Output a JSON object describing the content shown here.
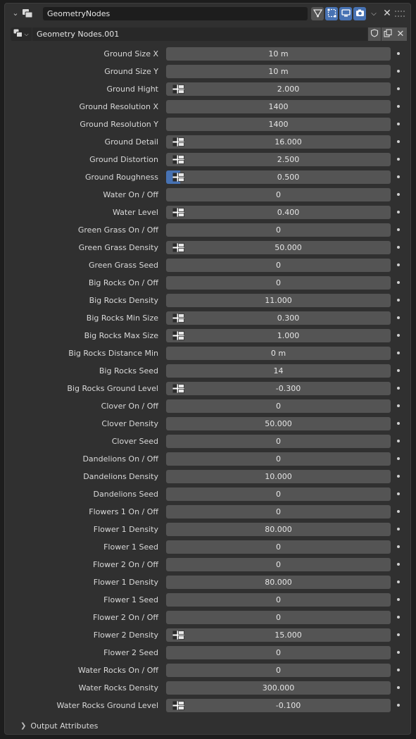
{
  "modifier": {
    "name": "GeometryNodes",
    "icon": "geometry-nodes-modifier-icon",
    "toggles": [
      {
        "icon": "edit-mode-icon",
        "active": false
      },
      {
        "icon": "on-cage-icon",
        "active": true
      },
      {
        "icon": "realtime-display-icon",
        "active": true
      },
      {
        "icon": "render-camera-icon",
        "active": true
      }
    ]
  },
  "node_group": {
    "name": "Geometry Nodes.001",
    "type_icon": "node-tree-icon"
  },
  "properties": [
    {
      "label": "Ground Size X",
      "value": "10 m",
      "icon": false
    },
    {
      "label": "Ground Size Y",
      "value": "10 m",
      "icon": false
    },
    {
      "label": "Ground Hight",
      "value": "2.000",
      "icon": true
    },
    {
      "label": "Ground Resolution X",
      "value": "1400",
      "icon": false
    },
    {
      "label": "Ground Resolution Y",
      "value": "1400",
      "icon": false
    },
    {
      "label": "Ground Detail",
      "value": "16.000",
      "icon": true
    },
    {
      "label": "Ground Distortion",
      "value": "2.500",
      "icon": true
    },
    {
      "label": "Ground Roughness",
      "value": "0.500",
      "icon": true,
      "fill": 0.5
    },
    {
      "label": "Water On / Off",
      "value": "0",
      "icon": false
    },
    {
      "label": "Water Level",
      "value": "0.400",
      "icon": true
    },
    {
      "label": "Green Grass On / Off",
      "value": "0",
      "icon": false
    },
    {
      "label": "Green Grass Density",
      "value": "50.000",
      "icon": true
    },
    {
      "label": "Green Grass Seed",
      "value": "0",
      "icon": false
    },
    {
      "label": "Big Rocks On / Off",
      "value": "0",
      "icon": false
    },
    {
      "label": "Big Rocks Density",
      "value": "11.000",
      "icon": false
    },
    {
      "label": "Big Rocks Min Size",
      "value": "0.300",
      "icon": true
    },
    {
      "label": "Big Rocks Max Size",
      "value": "1.000",
      "icon": true
    },
    {
      "label": "Big Rocks Distance Min",
      "value": "0 m",
      "icon": false
    },
    {
      "label": "Big Rocks Seed",
      "value": "14",
      "icon": false
    },
    {
      "label": "Big Rocks Ground Level",
      "value": "-0.300",
      "icon": true
    },
    {
      "label": "Clover On / Off",
      "value": "0",
      "icon": false
    },
    {
      "label": "Clover Density",
      "value": "50.000",
      "icon": false
    },
    {
      "label": "Clover Seed",
      "value": "0",
      "icon": false
    },
    {
      "label": "Dandelions On / Off",
      "value": "0",
      "icon": false
    },
    {
      "label": "Dandelions Density",
      "value": "10.000",
      "icon": false
    },
    {
      "label": "Dandelions Seed",
      "value": "0",
      "icon": false
    },
    {
      "label": "Flowers 1 On / Off",
      "value": "0",
      "icon": false
    },
    {
      "label": "Flower 1 Density",
      "value": "80.000",
      "icon": false
    },
    {
      "label": "Flower 1 Seed",
      "value": "0",
      "icon": false
    },
    {
      "label": "Flower 2 On / Off",
      "value": "0",
      "icon": false
    },
    {
      "label": "Flower 1 Density",
      "value": "80.000",
      "icon": false
    },
    {
      "label": "Flower 1 Seed",
      "value": "0",
      "icon": false
    },
    {
      "label": "Flower 2 On / Off",
      "value": "0",
      "icon": false
    },
    {
      "label": "Flower 2 Density",
      "value": "15.000",
      "icon": true
    },
    {
      "label": "Flower 2 Seed",
      "value": "0",
      "icon": false
    },
    {
      "label": "Water Rocks On / Off",
      "value": "0",
      "icon": false
    },
    {
      "label": "Water Rocks Density",
      "value": "300.000",
      "icon": false
    },
    {
      "label": "Water Rocks Ground Level",
      "value": "-0.100",
      "icon": true
    }
  ],
  "output_attributes": {
    "label": "Output Attributes"
  },
  "colors": {
    "panel_bg": "#303030",
    "field_bg": "#545454",
    "accent": "#4772b3",
    "text": "#d9d9d9"
  }
}
